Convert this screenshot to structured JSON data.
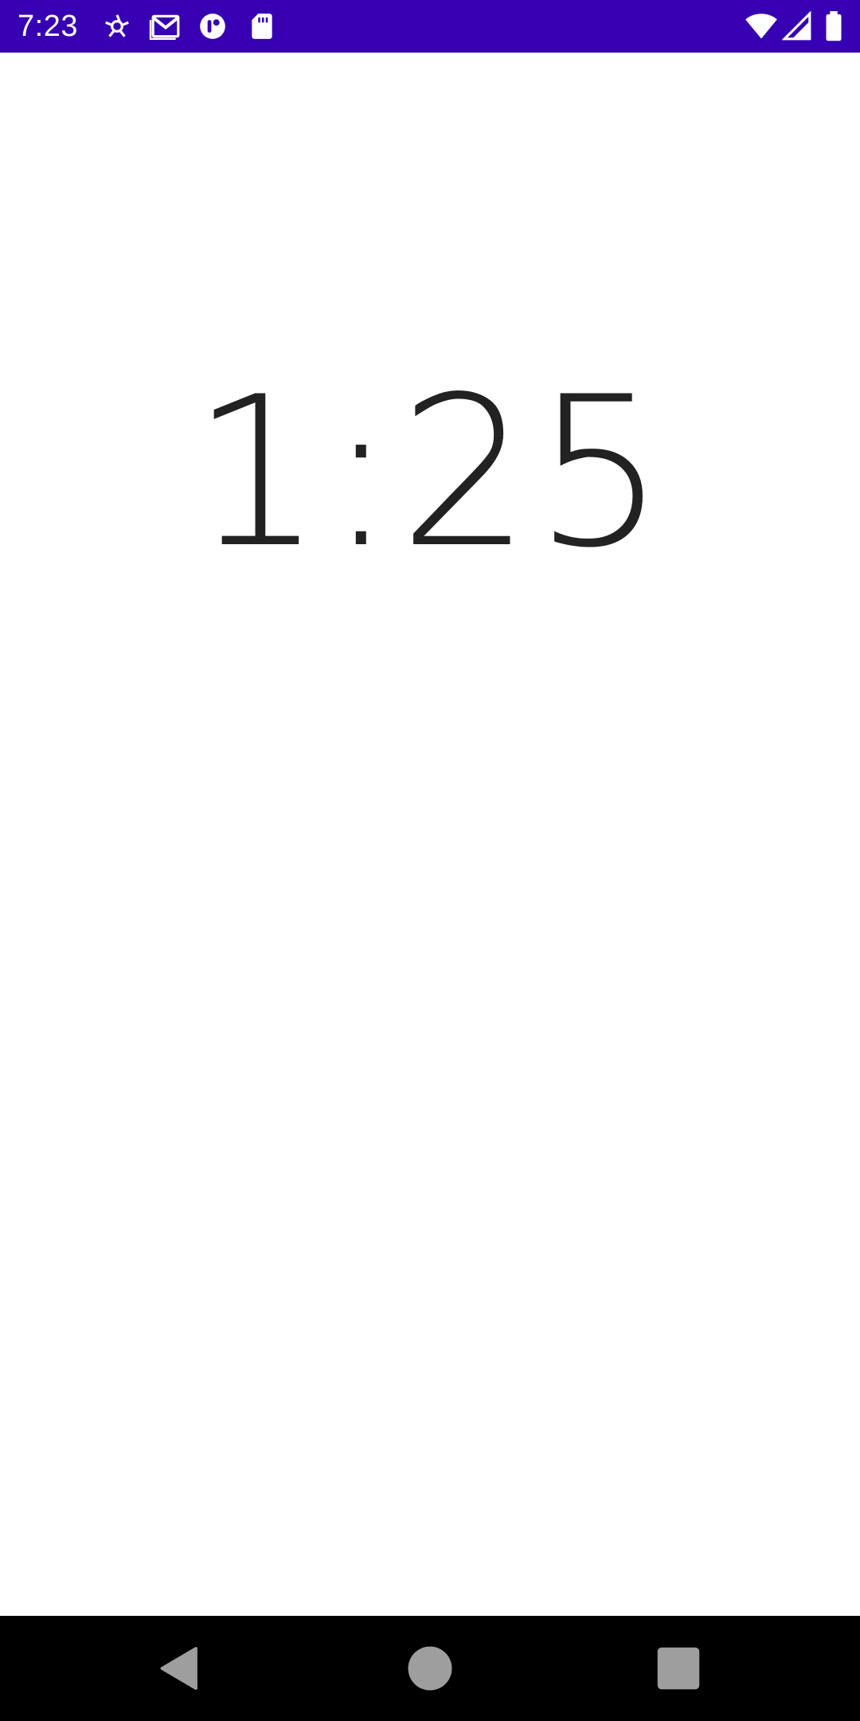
{
  "status_bar": {
    "time": "7:23",
    "background_color": "#3700b3",
    "icons": [
      "app-notification-icon",
      "gmail-icon",
      "record-icon",
      "sd-card-icon",
      "wifi-icon",
      "cellular-signal-icon",
      "battery-icon"
    ]
  },
  "timer": {
    "value": "1:25",
    "text_color": "#222222"
  },
  "navigation_bar": {
    "background_color": "#000000",
    "buttons": [
      "back-icon",
      "home-icon",
      "recents-icon"
    ],
    "icon_color": "#9e9e9e"
  }
}
